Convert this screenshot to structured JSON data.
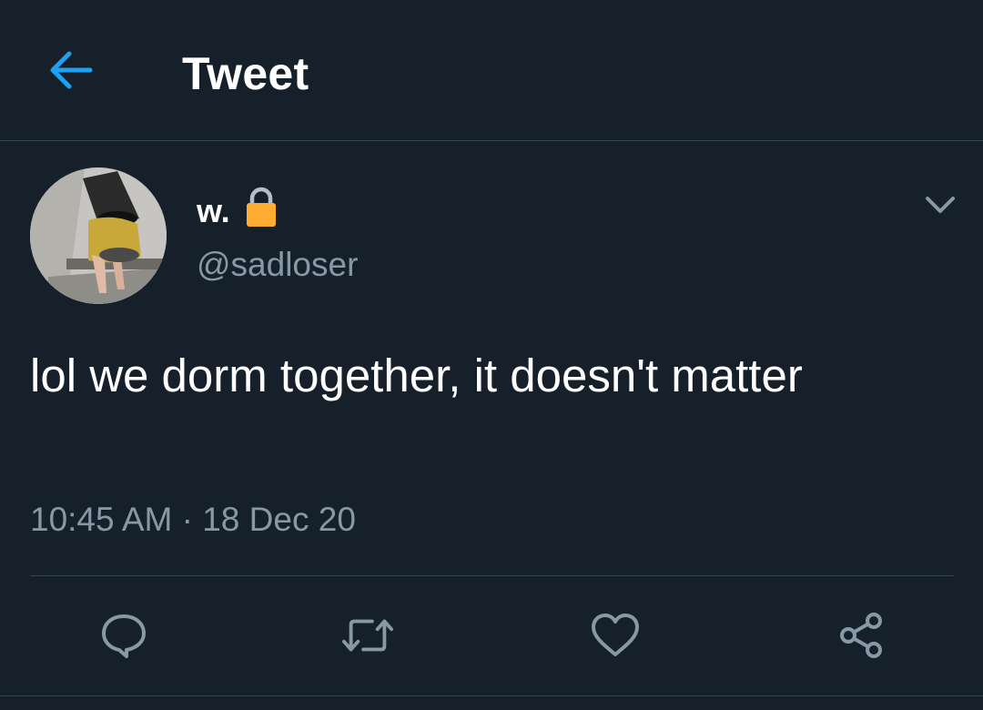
{
  "header": {
    "title": "Tweet",
    "back_icon": "arrow-left-icon"
  },
  "colors": {
    "background": "#15202b",
    "accent": "#1da1f2",
    "secondary_text": "#8899a6",
    "divider": "#38444d",
    "lock": "#ffac33"
  },
  "tweet": {
    "display_name": "w.",
    "protected_icon": "lock-icon",
    "handle": "@sadloser",
    "text": "lol we dorm together, it doesn't matter",
    "time": "10:45 AM",
    "separator": "·",
    "date": "18 Dec 20",
    "menu_icon": "chevron-down-icon"
  },
  "actions": [
    {
      "name": "reply",
      "icon": "speech-bubble-icon"
    },
    {
      "name": "retweet",
      "icon": "retweet-icon"
    },
    {
      "name": "like",
      "icon": "heart-icon"
    },
    {
      "name": "share",
      "icon": "share-icon"
    }
  ]
}
